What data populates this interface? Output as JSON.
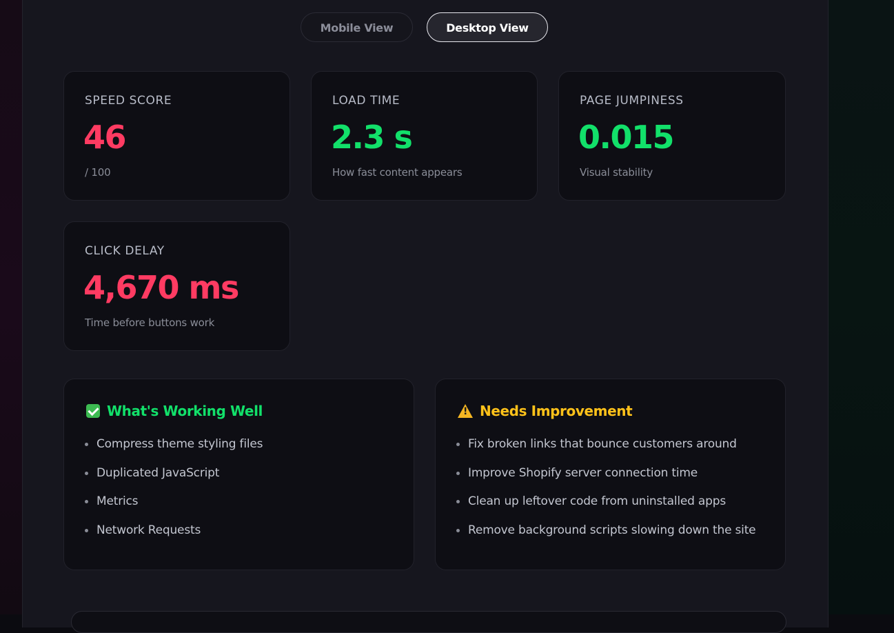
{
  "toggle": {
    "mobile_label": "Mobile View",
    "desktop_label": "Desktop View",
    "active": "Desktop View"
  },
  "metrics": [
    {
      "label": "SPEED SCORE",
      "value": "46",
      "sub": "/ 100",
      "status": "bad"
    },
    {
      "label": "LOAD TIME",
      "value": "2.3 s",
      "sub": "How fast content appears",
      "status": "good"
    },
    {
      "label": "PAGE JUMPINESS",
      "value": "0.015",
      "sub": "Visual stability",
      "status": "good"
    },
    {
      "label": "CLICK DELAY",
      "value": "4,670 ms",
      "sub": "Time before buttons work",
      "status": "bad"
    }
  ],
  "working_well": {
    "icon": "check-icon",
    "title": "What's Working Well",
    "items": [
      "Compress theme styling files",
      "Duplicated JavaScript",
      "Metrics",
      "Network Requests"
    ]
  },
  "needs_improvement": {
    "icon": "warning-icon",
    "title": "Needs Improvement",
    "items": [
      "Fix broken links that bounce customers around",
      "Improve Shopify server connection time",
      "Clean up leftover code from uninstalled apps",
      "Remove background scripts slowing down the site"
    ]
  },
  "colors": {
    "bad": "#ff3b62",
    "good": "#12e06a",
    "amber": "#ffc21a",
    "panel": "#16161e",
    "card": "#0e0e14"
  }
}
